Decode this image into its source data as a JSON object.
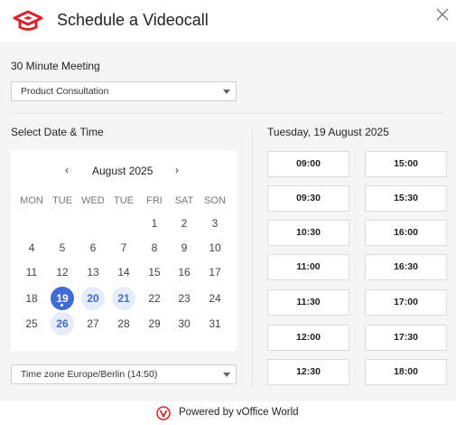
{
  "header": {
    "title": "Schedule a Videocall",
    "logo_icon": "graduation-cap-logo-icon",
    "close_icon": "close-icon"
  },
  "meeting": {
    "label": "30 Minute Meeting",
    "type_select": {
      "selected": "Product Consultation"
    }
  },
  "date_section": {
    "label": "Select Date & Time"
  },
  "calendar": {
    "month": "August 2025",
    "prev_label": "‹",
    "next_label": "›",
    "weekdays": [
      "MON",
      "TUE",
      "WED",
      "TUE",
      "FRI",
      "SAT",
      "SON"
    ],
    "weeks": [
      [
        "",
        "",
        "",
        "",
        "1",
        "2",
        "3"
      ],
      [
        "4",
        "5",
        "6",
        "7",
        "8",
        "9",
        "10"
      ],
      [
        "11",
        "12",
        "13",
        "14",
        "15",
        "16",
        "17"
      ],
      [
        "18",
        "19",
        "20",
        "21",
        "22",
        "23",
        "24"
      ],
      [
        "25",
        "26",
        "27",
        "28",
        "29",
        "30",
        "31"
      ]
    ],
    "selected_day": "19",
    "available_days": [
      "20",
      "21",
      "26"
    ]
  },
  "timezone_select": {
    "selected": "Time zone Europe/Berlin (14:50)"
  },
  "times": {
    "date_heading": "Tuesday, 19 August 2025",
    "left_column": [
      "09:00",
      "09:30",
      "10:30",
      "11:00",
      "11:30",
      "12:00",
      "12:30"
    ],
    "right_column": [
      "15:00",
      "15:30",
      "16:00",
      "16:30",
      "17:00",
      "17:30",
      "18:00"
    ]
  },
  "footer": {
    "powered_by": "Powered by vOffice World",
    "brand_icon": "voffice-logo-icon"
  },
  "colors": {
    "brand_red": "#d6262a",
    "accent_blue": "#3f6cd6",
    "available_bg": "#e6ecf9"
  }
}
